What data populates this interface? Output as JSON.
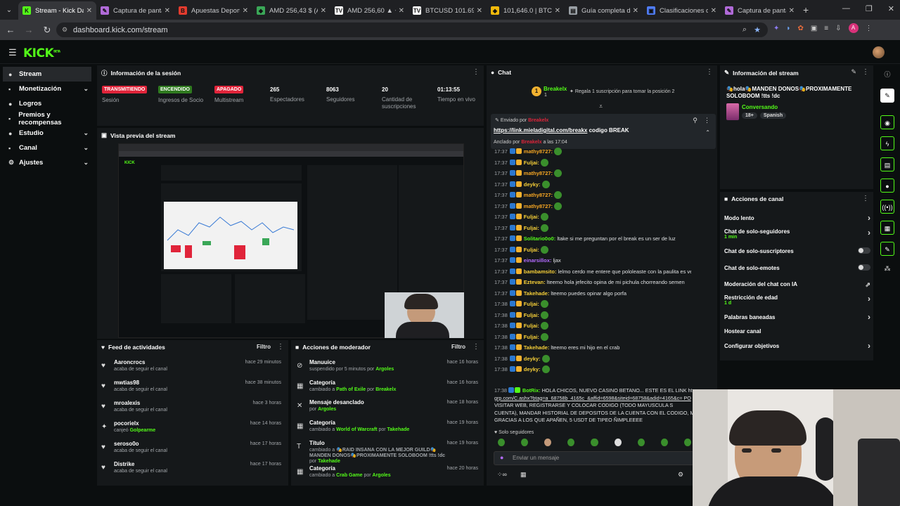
{
  "browser": {
    "tabs": [
      {
        "label": "Stream - Kick Dashboard",
        "fav_color": "#53fc18",
        "fav": "K"
      },
      {
        "label": "Captura de pantalla",
        "fav_color": "#b06ad8",
        "fav": "✎"
      },
      {
        "label": "Apuestas Deportivas",
        "fav_color": "#e33b2e",
        "fav": "B"
      },
      {
        "label": "AMD 256,43 $ (AMD)",
        "fav_color": "#3aa757",
        "fav": "◆"
      },
      {
        "label": "AMD 256,60 ▲ +1",
        "fav_color": "#ffffff",
        "fav": "TV"
      },
      {
        "label": "BTCUSD 101.693",
        "fav_color": "#ffffff",
        "fav": "TV"
      },
      {
        "label": "101,646.0 | BTCUSDT",
        "fav_color": "#f0b90b",
        "fav": "◆"
      },
      {
        "label": "Guía completa de",
        "fav_color": "#9aa0a6",
        "fav": "▤"
      },
      {
        "label": "Clasificaciones de",
        "fav_color": "#4f7cf7",
        "fav": "▣"
      },
      {
        "label": "Captura de pantalla",
        "fav_color": "#b06ad8",
        "fav": "✎"
      }
    ],
    "url": "dashboard.kick.com/stream"
  },
  "header": {
    "logo": "KICK",
    "logo_sup": "BETA"
  },
  "sidebar": {
    "items": [
      {
        "label": "Stream",
        "icon": "●",
        "chev": ""
      },
      {
        "label": "Monetización",
        "icon": "▪",
        "chev": "⌄"
      },
      {
        "label": "Logros",
        "icon": "●",
        "chev": ""
      },
      {
        "label": "Premios y recompensas",
        "icon": "▪",
        "chev": ""
      },
      {
        "label": "Estudio",
        "icon": "●",
        "chev": "⌄"
      },
      {
        "label": "Canal",
        "icon": "▪",
        "chev": "⌄"
      },
      {
        "label": "Ajustes",
        "icon": "⚙",
        "chev": "⌄"
      }
    ]
  },
  "session": {
    "title": "Información de la sesión",
    "stats": [
      {
        "value": "TRANSMITIENDO",
        "label": "Sesión",
        "kind": "badge",
        "color": "#e0243a"
      },
      {
        "value": "ENCENDIDO",
        "label": "Ingresos de Socio",
        "kind": "badge",
        "color": "#2f7a1f"
      },
      {
        "value": "APAGADO",
        "label": "Multistream",
        "kind": "badge",
        "color": "#e0243a"
      },
      {
        "value": "265",
        "label": "Espectadores",
        "kind": "num"
      },
      {
        "value": "8063",
        "label": "Seguidores",
        "kind": "num"
      },
      {
        "value": "20",
        "label": "Cantidad de suscripciones",
        "kind": "num"
      },
      {
        "value": "01:13:55",
        "label": "Tiempo en vivo",
        "kind": "num"
      }
    ]
  },
  "preview": {
    "title": "Vista previa del stream"
  },
  "activity": {
    "title": "Feed de actividades",
    "filter": "Filtro",
    "items": [
      {
        "name": "Aaroncrocs",
        "desc": "acaba de seguir el canal",
        "extra": "",
        "time": "hace 29 minutos",
        "icon": "♥"
      },
      {
        "name": "mwtias98",
        "desc": "acaba de seguir el canal",
        "extra": "",
        "time": "hace 38 minutos",
        "icon": "♥"
      },
      {
        "name": "mroalexis",
        "desc": "acaba de seguir el canal",
        "extra": "",
        "time": "hace 3 horas",
        "icon": "♥"
      },
      {
        "name": "pocorielx",
        "desc": "canjeó",
        "extra": "Golpearme",
        "time": "hace 14 horas",
        "icon": "✦"
      },
      {
        "name": "seroso0o",
        "desc": "acaba de seguir el canal",
        "extra": "",
        "time": "hace 17 horas",
        "icon": "♥"
      },
      {
        "name": "Distrike",
        "desc": "acaba de seguir el canal",
        "extra": "",
        "time": "hace 17 horas",
        "icon": "♥"
      }
    ]
  },
  "modactions": {
    "title": "Acciones de moderador",
    "filter": "Filtro",
    "items": [
      {
        "action": "Manuuice",
        "desc": "suspendido por 5 minutos por",
        "actor": "Argoles",
        "detail": "",
        "time": "hace 16 horas",
        "icon": "⊘"
      },
      {
        "action": "Categoría",
        "desc": "cambiado a",
        "detail": "Path of Exile",
        "actor": "Breakelx",
        "time": "hace 16 horas",
        "icon": "▦"
      },
      {
        "action": "Mensaje desanclado",
        "desc": "por",
        "actor": "Argoles",
        "detail": "",
        "time": "hace 18 horas",
        "icon": "✕"
      },
      {
        "action": "Categoría",
        "desc": "cambiado a",
        "detail": "World of Warcraft",
        "actor": "Takehade",
        "time": "hace 19 horas",
        "icon": "▦"
      },
      {
        "action": "Título",
        "desc": "cambiado a",
        "detail": "🎭RAID INSANA CON LA MEJOR GUILD🎭MANDEN DONOS🎭PROXIMAMENTE SOLOBOOM !tts !dc",
        "actor": "Takehade",
        "time": "hace 19 horas",
        "icon": "T"
      },
      {
        "action": "Categoría",
        "desc": "cambiado a",
        "detail": "Crab Game",
        "actor": "Argoles",
        "time": "hace 20 horas",
        "icon": "▦"
      }
    ]
  },
  "chat": {
    "title": "Chat",
    "top_gifter": {
      "name": "Breakelx",
      "count": "1",
      "rank": "1",
      "note": "Regala 1 suscripción para tomar la posición 2"
    },
    "pinned": {
      "sent_by_label": "Enviado por",
      "sender": "Breakelx",
      "link": "https://link.mieladigital.com/breakx",
      "text": "codigo BREAK",
      "pinned_by_label": "Anclado por",
      "pinner": "Breakelx",
      "time": "a las 17:04"
    },
    "messages": [
      {
        "time": "17:37",
        "user": "mathy8727:",
        "color": "#f5a623",
        "text": "",
        "emote": true
      },
      {
        "time": "17:37",
        "user": "Fuljai:",
        "color": "#f7d038",
        "text": "",
        "emote": true
      },
      {
        "time": "17:37",
        "user": "mathy8727:",
        "color": "#f5a623",
        "text": "",
        "emote": true
      },
      {
        "time": "17:37",
        "user": "deyky:",
        "color": "#f7d038",
        "text": "",
        "emote": true
      },
      {
        "time": "17:37",
        "user": "mathy8727:",
        "color": "#f5a623",
        "text": "",
        "emote": true
      },
      {
        "time": "17:37",
        "user": "mathy8727:",
        "color": "#f5a623",
        "text": "",
        "emote": true
      },
      {
        "time": "17:37",
        "user": "Fuljai:",
        "color": "#f7d038",
        "text": "",
        "emote": true
      },
      {
        "time": "17:37",
        "user": "Fuljai:",
        "color": "#f7d038",
        "text": "",
        "emote": true
      },
      {
        "time": "17:37",
        "user": "Solitario0o0:",
        "color": "#53fc18",
        "text": "ltake si me preguntan por el break es un ser de luz",
        "emote": false
      },
      {
        "time": "17:37",
        "user": "Fuljai:",
        "color": "#f7d038",
        "text": "",
        "emote": true
      },
      {
        "time": "17:37",
        "user": "einarsillox:",
        "color": "#b36bff",
        "text": "ljax",
        "emote": false
      },
      {
        "time": "17:37",
        "user": "bambamsito:",
        "color": "#f7d038",
        "text": "lelmo cerdo me entere que pololeaste con la paulita es verdad?",
        "emote": false
      },
      {
        "time": "17:37",
        "user": "Eztevan:",
        "color": "#f7d038",
        "text": "lteemo hola jefecito opina de mi pichula chorreando semen",
        "emote": false
      },
      {
        "time": "17:37",
        "user": "Takehade:",
        "color": "#f7d038",
        "text": "lteemo puedes opinar algo porfa",
        "emote": false
      },
      {
        "time": "17:38",
        "user": "Fuljai:",
        "color": "#f7d038",
        "text": "",
        "emote": true
      },
      {
        "time": "17:38",
        "user": "Fuljai:",
        "color": "#f7d038",
        "text": "",
        "emote": true
      },
      {
        "time": "17:38",
        "user": "Fuljai:",
        "color": "#f7d038",
        "text": "",
        "emote": true
      },
      {
        "time": "17:38",
        "user": "Fuljai:",
        "color": "#f7d038",
        "text": "",
        "emote": true
      },
      {
        "time": "17:38",
        "user": "Takehade:",
        "color": "#f7d038",
        "text": "lteemo eres mi hijo en el crab",
        "emote": false
      },
      {
        "time": "17:38",
        "user": "deyky:",
        "color": "#f7d038",
        "text": "",
        "emote": true
      },
      {
        "time": "17:38",
        "user": "deyky:",
        "color": "#f7d038",
        "text": "",
        "emote": true
      }
    ],
    "botrix": {
      "time": "17:38",
      "user": "BotRix:",
      "line1": "HOLA CHICOS, NUEVO CASINO BETANO... ESTE ES EL LINK https://...",
      "line2": "grp.com/C.ashx?btag=a_68758b_4165c_&affid=6598&siteid=68758&adid=4165&c= PO",
      "line3": "VISITAR WEB, REGISTRARSE Y COLOCAR CODIGO          (TODO MAYUSCULA S",
      "line4": "CUENTA), MANDAR HISTORIAL DE DEPOSITOS DE LA CUENTA CON EL CODIGO, MU",
      "line5": "GRACIAS A LOS QUE APAÑEN, 5 USDT DE TIPEO ÑIMPLEEEE"
    },
    "followers_only": "Solo seguidores",
    "input_placeholder": "Enviar un mensaje"
  },
  "stream_info": {
    "title": "Información del stream",
    "stream_title": "🎭hola🎭MANDEN DONOS🎭PROXIMAMENTE SOLOBOOM !tts !dc",
    "category": "Conversando",
    "tags": [
      "18+",
      "Spanish"
    ]
  },
  "channel_actions": {
    "title": "Acciones de canal",
    "items": [
      {
        "label": "Modo lento",
        "sub": "",
        "control": "arrow"
      },
      {
        "label": "Chat de solo-seguidores",
        "sub": "1 min",
        "control": "arrow"
      },
      {
        "label": "Chat de solo-suscriptores",
        "sub": "",
        "control": "toggle"
      },
      {
        "label": "Chat de solo-emotes",
        "sub": "",
        "control": "toggle"
      },
      {
        "label": "Moderación del chat con IA",
        "sub": "",
        "control": "external"
      },
      {
        "label": "Restricción de edad",
        "sub": "1 d",
        "control": "arrow"
      },
      {
        "label": "Palabras baneadas",
        "sub": "",
        "control": "arrow"
      },
      {
        "label": "Hostear canal",
        "sub": "",
        "control": "none"
      },
      {
        "label": "Configurar objetivos",
        "sub": "",
        "control": "arrow"
      }
    ]
  },
  "colors": {
    "accent": "#53fc18",
    "panel": "#15181a",
    "bg": "#0b0e0f",
    "live": "#e0243a"
  }
}
